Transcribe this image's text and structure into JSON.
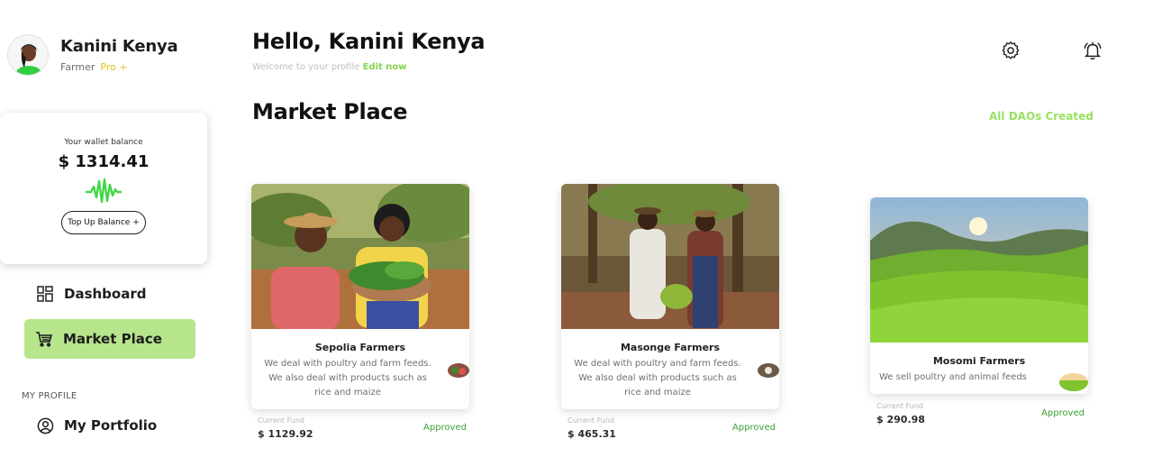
{
  "profile": {
    "name": "Kanini Kenya",
    "role": "Farmer",
    "tier": "Pro +"
  },
  "wallet": {
    "label": "Your wallet balance",
    "balance": "$ 1314.41",
    "topup_label": "Top Up Balance +"
  },
  "nav": {
    "dashboard": "Dashboard",
    "marketplace": "Market Place",
    "section_label": "MY PROFILE",
    "portfolio": "My Portfolio"
  },
  "header": {
    "greeting": "Hello, Kanini Kenya",
    "welcome": "Welcome to your profile",
    "edit_label": "Edit now"
  },
  "market": {
    "title": "Market Place",
    "all_daos_label": "All DAOs Created",
    "cards": [
      {
        "name": "Sepolia Farmers",
        "description": "We deal with poultry and farm feeds. We also deal with products such as rice and maize",
        "fund_label": "Current Fund",
        "fund_value": "$ 1129.92",
        "status": "Approved"
      },
      {
        "name": "Masonge Farmers",
        "description": "We deal with poultry and farm feeds. We also deal with products such as rice and maize",
        "fund_label": "Current Fund",
        "fund_value": "$ 465.31",
        "status": "Approved"
      },
      {
        "name": "Mosomi Farmers",
        "description": "We sell poultry and animal feeds",
        "fund_label": "Current Fund",
        "fund_value": "$ 290.98",
        "status": "Approved"
      }
    ]
  },
  "icons": {
    "settings": "settings-gear-icon",
    "notifications": "bell-icon",
    "dashboard": "grid-icon",
    "marketplace": "cart-icon",
    "portfolio": "user-circle-icon",
    "wallet_activity": "pulse-wave-icon"
  },
  "colors": {
    "accent_green": "#b6e58c",
    "link_green": "#99e063",
    "approved_green": "#3aa134",
    "pro_yellow": "#e2c21c"
  }
}
